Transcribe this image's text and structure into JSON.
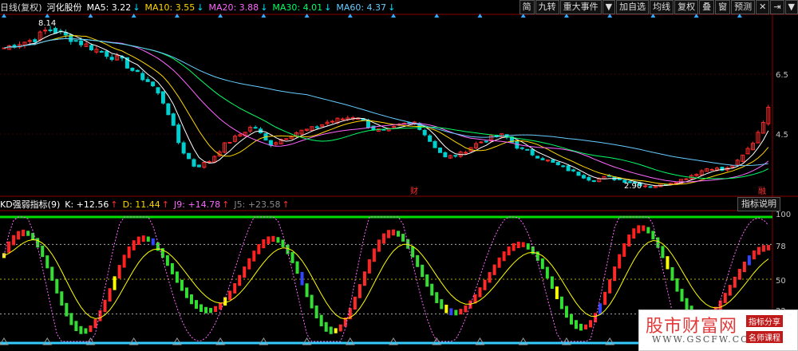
{
  "header": {
    "period_label": "日线(复权)",
    "stock_name": "河化股份",
    "ma": [
      {
        "label": "MA5: 3.22",
        "arrow": "↓",
        "color": "#ffffff"
      },
      {
        "label": "MA10: 3.55",
        "arrow": "↓",
        "color": "#ffd700"
      },
      {
        "label": "MA20: 3.88",
        "arrow": "↓",
        "color": "#ff66ff"
      },
      {
        "label": "MA30: 4.01",
        "arrow": "↓",
        "color": "#00ff66"
      },
      {
        "label": "MA60: 4.37",
        "arrow": "↓",
        "color": "#66ccff"
      }
    ]
  },
  "toolbar": {
    "buttons": [
      "简",
      "九转",
      "重大事件",
      "▼",
      "加自选",
      "均线",
      "复权",
      "叠",
      "窗",
      "预测"
    ],
    "close_glyph": "✕",
    "pin_glyph": "⇥",
    "menu_glyph": "▼"
  },
  "price_axis": {
    "labels": [
      "6.5",
      "4.5"
    ]
  },
  "annotations": {
    "high_label": "8.14",
    "low_label": "2.90",
    "cai_marker": "财",
    "rong_marker": "融"
  },
  "indicator": {
    "title": "KD强弱指标(9)",
    "k": {
      "label": "K: +12.56",
      "arrow": "↑",
      "color": "#ffffff"
    },
    "d": {
      "label": "D: 11.44",
      "arrow": "↑",
      "color": "#ffd700"
    },
    "j9": {
      "label": "J9: +14.78",
      "arrow": "↑",
      "color": "#ff66ff"
    },
    "j5": {
      "label": "J5: +23.58",
      "arrow": "↑",
      "color": "#888888"
    },
    "explain_button": "指标说明",
    "axis_labels": [
      "100",
      "78",
      "50",
      "22"
    ]
  },
  "watermark": {
    "main": "股市财富网",
    "url": "WWW.GSCFW.COM",
    "tag1": "指标分享",
    "tag2": "名师课程"
  },
  "colors": {
    "up": "#ff2a2a",
    "down": "#00cfcf",
    "yellow": "#ffff00",
    "pink": "#ff66ff",
    "green_bar": "#33dd33",
    "blue_bar": "#3344ff",
    "red_bar": "#ff2020",
    "axis_text": "#c0c0c0"
  },
  "chart_data": {
    "type": "candlestick",
    "price_range": [
      2.9,
      8.14
    ],
    "close_trend": [
      7.3,
      7.45,
      7.55,
      7.9,
      7.7,
      7.5,
      7.3,
      7.1,
      6.9,
      6.5,
      6.2,
      5.5,
      4.2,
      3.6,
      3.8,
      4.3,
      4.6,
      4.9,
      4.3,
      4.5,
      4.7,
      4.8,
      5.0,
      5.1,
      5.2,
      4.8,
      4.7,
      4.9,
      5.0,
      4.4,
      3.9,
      4.0,
      4.3,
      4.5,
      4.6,
      4.2,
      4.0,
      3.8,
      3.6,
      3.4,
      3.2,
      3.3,
      3.2,
      3.1,
      3.0,
      3.1,
      3.2,
      3.4,
      3.6,
      3.5,
      3.8,
      4.4,
      5.4
    ]
  }
}
